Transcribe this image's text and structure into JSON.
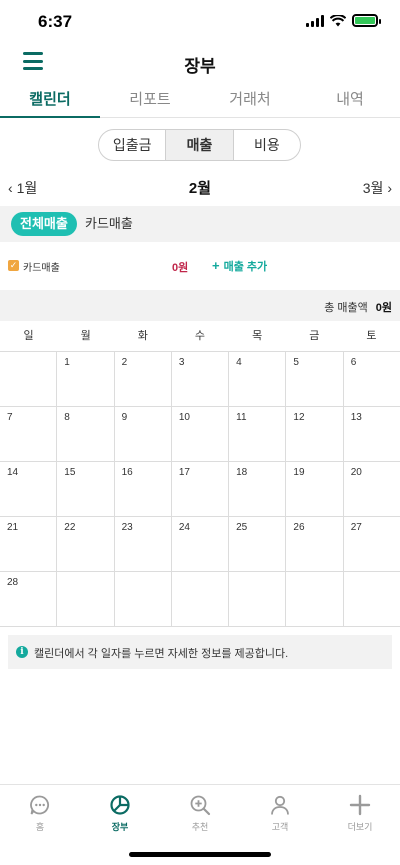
{
  "status_bar": {
    "time": "6:37"
  },
  "header": {
    "title": "장부"
  },
  "tabs": [
    {
      "label": "캘린더",
      "active": true
    },
    {
      "label": "리포트",
      "active": false
    },
    {
      "label": "거래처",
      "active": false
    },
    {
      "label": "내역",
      "active": false
    }
  ],
  "segment": [
    {
      "label": "입출금",
      "active": false
    },
    {
      "label": "매출",
      "active": true
    },
    {
      "label": "비용",
      "active": false
    }
  ],
  "month_nav": {
    "prev": "1월",
    "current": "2월",
    "next": "3월"
  },
  "filters": {
    "all_sales": "전체매출",
    "card_sales": "카드매출"
  },
  "sales_row": {
    "label": "카드매출",
    "amount": "0원",
    "add_label": "매출 추가"
  },
  "total": {
    "label": "총 매출액",
    "value": "0원"
  },
  "weekdays": [
    "일",
    "월",
    "화",
    "수",
    "목",
    "금",
    "토"
  ],
  "calendar_weeks": [
    [
      "",
      "1",
      "2",
      "3",
      "4",
      "5",
      "6"
    ],
    [
      "7",
      "8",
      "9",
      "10",
      "11",
      "12",
      "13"
    ],
    [
      "14",
      "15",
      "16",
      "17",
      "18",
      "19",
      "20"
    ],
    [
      "21",
      "22",
      "23",
      "24",
      "25",
      "26",
      "27"
    ],
    [
      "28",
      "",
      "",
      "",
      "",
      "",
      ""
    ]
  ],
  "info": {
    "text": "캘린더에서 각 일자를 누르면 자세한 정보를 제공합니다."
  },
  "bottom_nav": [
    {
      "label": "홈",
      "icon": "chat-bubble-icon",
      "active": false
    },
    {
      "label": "장부",
      "icon": "pie-chart-icon",
      "active": true
    },
    {
      "label": "추천",
      "icon": "zoom-plus-icon",
      "active": false
    },
    {
      "label": "고객",
      "icon": "person-icon",
      "active": false
    },
    {
      "label": "더보기",
      "icon": "plus-icon",
      "active": false
    }
  ],
  "colors": {
    "primary": "#0b6b63",
    "accent": "#1fbfb2",
    "amount": "#c0264a",
    "checkbox": "#f0a640"
  }
}
